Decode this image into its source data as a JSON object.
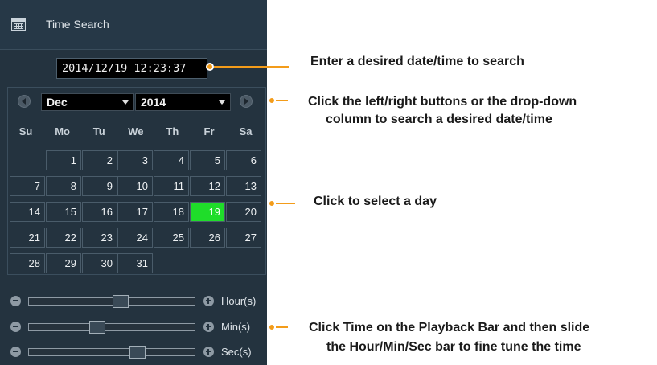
{
  "panel": {
    "title": "Time Search",
    "datetime_value": "2014/12/19 12:23:37",
    "month": "Dec",
    "year": "2014",
    "weekdays": [
      "Su",
      "Mo",
      "Tu",
      "We",
      "Th",
      "Fr",
      "Sa"
    ],
    "days": [
      "1",
      "2",
      "3",
      "4",
      "5",
      "6",
      "7",
      "8",
      "9",
      "10",
      "11",
      "12",
      "13",
      "14",
      "15",
      "16",
      "17",
      "18",
      "19",
      "20",
      "21",
      "22",
      "23",
      "24",
      "25",
      "26",
      "27",
      "28",
      "29",
      "30",
      "31"
    ],
    "first_weekday_index": 1,
    "selected_day": "19",
    "sliders": [
      {
        "label": "Hour(s)",
        "level": 0.55
      },
      {
        "label": "Min(s)",
        "level": 0.41
      },
      {
        "label": "Sec(s)",
        "level": 0.65
      }
    ]
  },
  "callouts": {
    "datetime": "Enter a desired date/time to search",
    "navigation_line1": "Click the left/right buttons or the drop-down",
    "navigation_line2": "column to search a desired date/time",
    "select_day": "Click to select a day",
    "sliders_line1": "Click Time on the Playback Bar and then slide",
    "sliders_line2": "the Hour/Min/Sec bar to fine tune the time"
  },
  "colors": {
    "panel_bg": "#24333f",
    "selected_day": "#1fdd2a",
    "callout_accent": "#f39c1a"
  },
  "icons": [
    "calendar-icon",
    "chevron-left-icon",
    "chevron-right-icon",
    "chevron-down-icon",
    "minus-icon",
    "plus-icon"
  ]
}
